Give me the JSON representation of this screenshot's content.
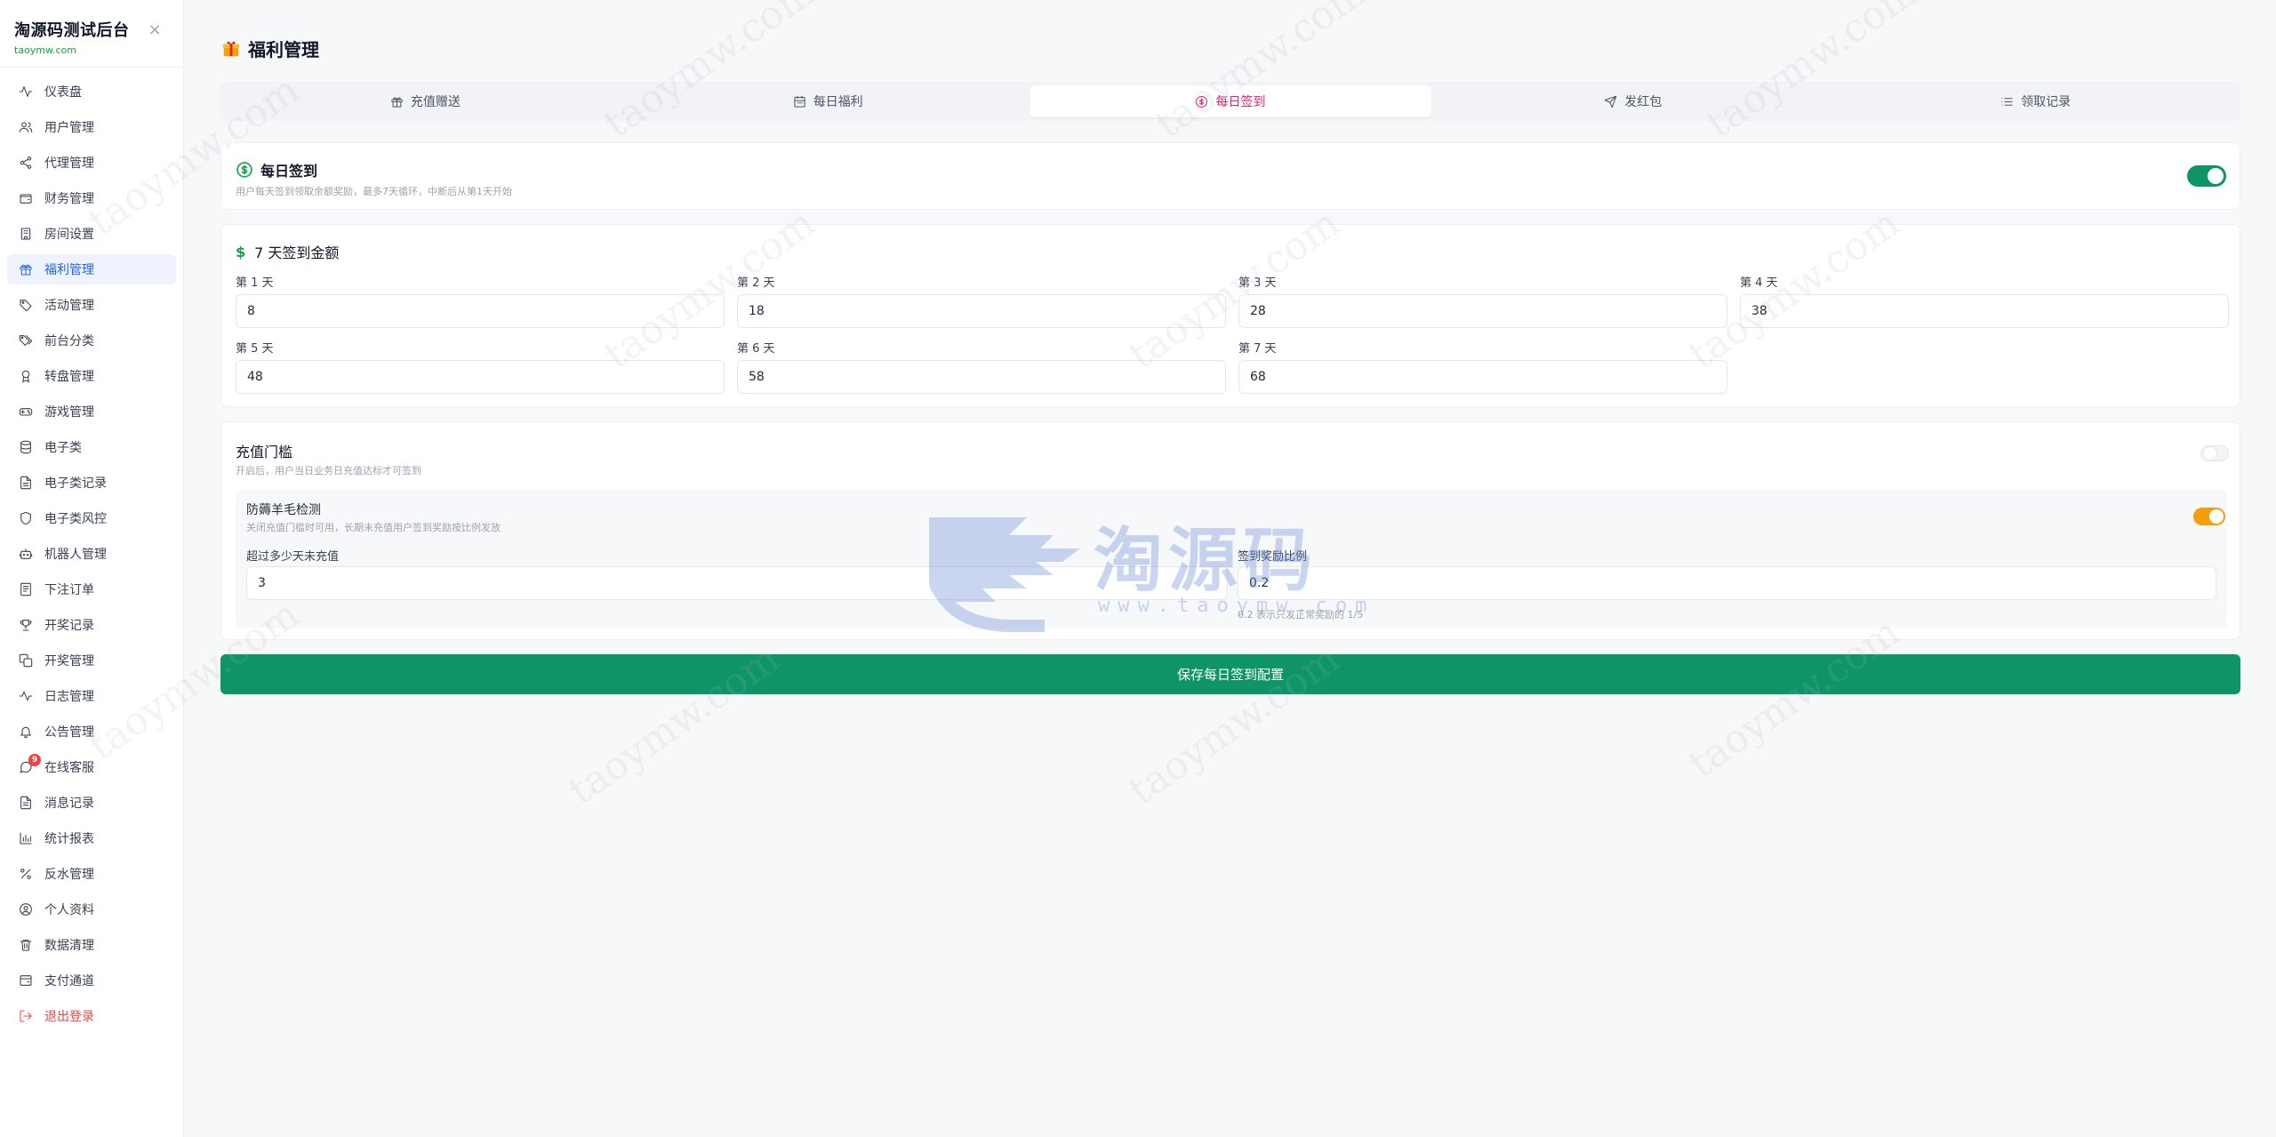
{
  "brand": {
    "title": "淘源码测试后台",
    "subtitle": "taoymw.com"
  },
  "sidebar": {
    "items": [
      {
        "label": "仪表盘",
        "icon": "activity-icon"
      },
      {
        "label": "用户管理",
        "icon": "users-icon"
      },
      {
        "label": "代理管理",
        "icon": "share-icon"
      },
      {
        "label": "财务管理",
        "icon": "wallet-icon"
      },
      {
        "label": "房间设置",
        "icon": "building-icon"
      },
      {
        "label": "福利管理",
        "icon": "gift-icon",
        "active": true
      },
      {
        "label": "活动管理",
        "icon": "tag-icon"
      },
      {
        "label": "前台分类",
        "icon": "tags-icon"
      },
      {
        "label": "转盘管理",
        "icon": "award-icon"
      },
      {
        "label": "游戏管理",
        "icon": "gamepad-icon"
      },
      {
        "label": "电子类",
        "icon": "database-icon"
      },
      {
        "label": "电子类记录",
        "icon": "file-icon"
      },
      {
        "label": "电子类风控",
        "icon": "shield-icon"
      },
      {
        "label": "机器人管理",
        "icon": "bot-icon"
      },
      {
        "label": "下注订单",
        "icon": "receipt-icon"
      },
      {
        "label": "开奖记录",
        "icon": "trophy-icon"
      },
      {
        "label": "开奖管理",
        "icon": "dice-icon"
      },
      {
        "label": "日志管理",
        "icon": "pulse-icon"
      },
      {
        "label": "公告管理",
        "icon": "bell-icon"
      },
      {
        "label": "在线客服",
        "icon": "chat-icon",
        "badge": "9"
      },
      {
        "label": "消息记录",
        "icon": "file-text-icon"
      },
      {
        "label": "统计报表",
        "icon": "bar-chart-icon"
      },
      {
        "label": "反水管理",
        "icon": "percent-icon"
      },
      {
        "label": "个人资料",
        "icon": "user-circle-icon"
      },
      {
        "label": "数据清理",
        "icon": "trash-icon"
      },
      {
        "label": "支付通道",
        "icon": "card-icon"
      },
      {
        "label": "退出登录",
        "icon": "logout-icon",
        "logout": true
      }
    ]
  },
  "page": {
    "title": "福利管理"
  },
  "tabs": [
    {
      "label": "充值赠送",
      "icon": "gift-icon"
    },
    {
      "label": "每日福利",
      "icon": "calendar-icon"
    },
    {
      "label": "每日签到",
      "icon": "dollar-circle-icon",
      "active": true
    },
    {
      "label": "发红包",
      "icon": "send-icon"
    },
    {
      "label": "领取记录",
      "icon": "list-icon"
    }
  ],
  "daily_checkin": {
    "title": "每日签到",
    "description": "用户每天签到领取余额奖励，最多7天循环，中断后从第1天开始",
    "enabled": true
  },
  "amounts": {
    "title": "7 天签到金额",
    "days": [
      {
        "label": "第 1 天",
        "value": "8"
      },
      {
        "label": "第 2 天",
        "value": "18"
      },
      {
        "label": "第 3 天",
        "value": "28"
      },
      {
        "label": "第 4 天",
        "value": "38"
      },
      {
        "label": "第 5 天",
        "value": "48"
      },
      {
        "label": "第 6 天",
        "value": "58"
      },
      {
        "label": "第 7 天",
        "value": "68"
      }
    ]
  },
  "recharge_threshold": {
    "title": "充值门槛",
    "description": "开启后，用户当日业务日充值达标才可签到",
    "enabled": false
  },
  "anti_abuse": {
    "title": "防薅羊毛检测",
    "description": "关闭充值门槛时可用，长期未充值用户签到奖励按比例发放",
    "enabled": true,
    "days_label": "超过多少天未充值",
    "days_value": "3",
    "ratio_label": "签到奖励比例",
    "ratio_value": "0.2",
    "ratio_hint": "0.2 表示只发正常奖励的 1/5"
  },
  "save_button": "保存每日签到配置",
  "watermark": {
    "text": "taoymw.com",
    "logo_text": "淘源码",
    "logo_url": "www.taoymw.com"
  },
  "colors": {
    "accent_green": "#0f9468",
    "tab_active": "#db2777",
    "nav_active": "#2563eb",
    "toggle_orange": "#f59e0b",
    "logout": "#ef4444"
  }
}
